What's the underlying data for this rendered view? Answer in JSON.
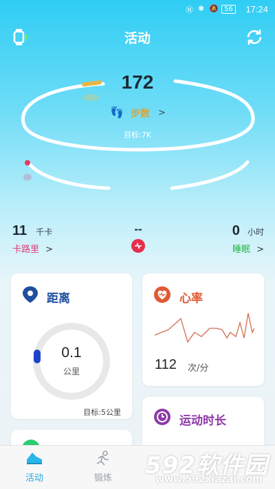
{
  "status_bar": {
    "time": "17:24",
    "battery": "56",
    "icons": [
      "nfc-icon",
      "bluetooth-icon",
      "mute-icon",
      "battery-icon"
    ]
  },
  "header": {
    "title": "活动",
    "left_icon": "watch-icon",
    "right_icon": "refresh-icon"
  },
  "steps": {
    "value": "172",
    "label": "步数",
    "arrow": ">",
    "goal": "目标:7K"
  },
  "metrics": {
    "calories": {
      "value": "11",
      "unit": "千卡",
      "label": "卡路里",
      "arrow": ">",
      "color": "#e0407b"
    },
    "center": {
      "value": "--"
    },
    "sleep": {
      "value": "0",
      "unit": "小时",
      "label": "睡眠",
      "arrow": ">",
      "color": "#2ab24a"
    }
  },
  "cards": {
    "distance": {
      "title": "距离",
      "value": "0.1",
      "unit": "公里",
      "goal": "目标:5公里",
      "progress": 0.02,
      "color": "#1f4f9e"
    },
    "heart_rate": {
      "title": "心率",
      "value": "112",
      "unit": "次/分",
      "color": "#e05a33"
    },
    "duration": {
      "title": "运动时长",
      "color": "#8e3aa8"
    }
  },
  "tabs": [
    {
      "label": "活动",
      "active": true
    },
    {
      "label": "锻炼",
      "active": false
    }
  ],
  "watermark": {
    "text": "592软件园",
    "url": "www.592xiazai.com"
  }
}
